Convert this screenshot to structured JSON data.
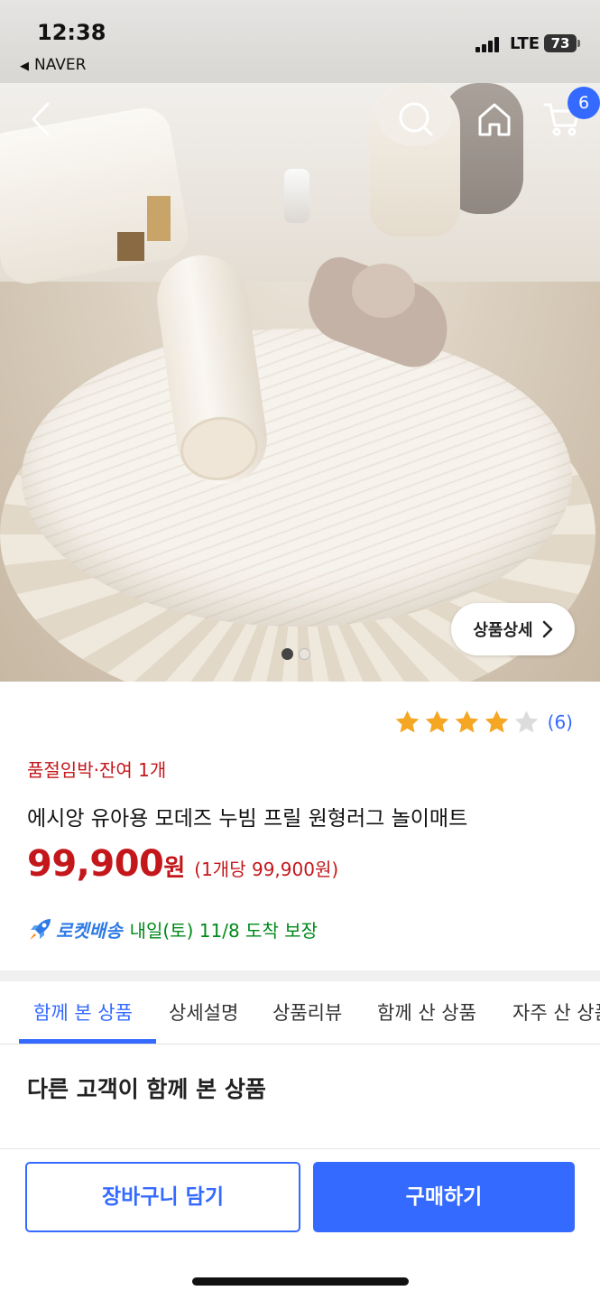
{
  "status_bar": {
    "time": "12:38",
    "back_app": "NAVER",
    "network": "LTE",
    "battery": "73"
  },
  "header": {
    "cart_count": "6",
    "icons": [
      "back-arrow-icon",
      "search-icon",
      "home-icon",
      "cart-icon"
    ]
  },
  "gallery": {
    "detail_button": "상품상세",
    "page_count": 2,
    "current_page": 1
  },
  "product": {
    "rating": 4,
    "rating_max": 5,
    "review_count": "(6)",
    "stock_notice": "품절임박·잔여 1개",
    "title": "에시앙 유아용 모데즈 누빔 프릴 원형러그 놀이매트",
    "price": "99,900",
    "price_unit": "원",
    "unit_price": "(1개당 99,900원)",
    "delivery_label": "로켓배송",
    "delivery_text": "내일(토) 11/8 도착 보장"
  },
  "tabs": [
    {
      "label": "함께 본 상품",
      "active": true
    },
    {
      "label": "상세설명",
      "active": false
    },
    {
      "label": "상품리뷰",
      "active": false
    },
    {
      "label": "함께 산 상품",
      "active": false
    },
    {
      "label": "자주 산 상품",
      "active": false
    }
  ],
  "section": {
    "title": "다른 고객이 함께 본 상품"
  },
  "actions": {
    "add_to_cart": "장바구니 담기",
    "buy_now": "구매하기"
  },
  "colors": {
    "accent": "#346aff",
    "price_red": "#c4171b",
    "delivery_green": "#00891a",
    "star": "#f5a623"
  }
}
